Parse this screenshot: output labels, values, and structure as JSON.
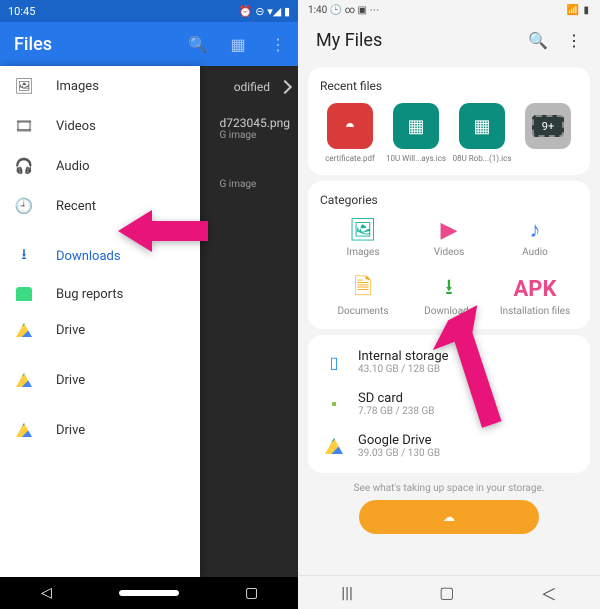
{
  "left": {
    "status_time": "10:45",
    "app_title": "Files",
    "sort_label": "odified",
    "bg_file_name": "d723045.png",
    "bg_file_sub": "G image",
    "bg_file_sub2": "G image",
    "drawer": [
      {
        "icon": "🖼",
        "label": "Images"
      },
      {
        "icon": "🎞",
        "label": "Videos"
      },
      {
        "icon": "🎧",
        "label": "Audio"
      },
      {
        "icon": "🕘",
        "label": "Recent"
      }
    ],
    "downloads_label": "Downloads",
    "bug_label": "Bug reports",
    "drive_label": "Drive"
  },
  "right": {
    "status_time": "1:40",
    "title": "My Files",
    "recent_title": "Recent files",
    "recent": [
      {
        "label": "certificate.pdf"
      },
      {
        "label": "10U Will...ays.ics"
      },
      {
        "label": "08U Rob...(1).ics"
      },
      {
        "label": ""
      }
    ],
    "nine_plus": "9+",
    "categories_title": "Categories",
    "cats": [
      {
        "label": "Images"
      },
      {
        "label": "Videos"
      },
      {
        "label": "Audio"
      },
      {
        "label": "Documents"
      },
      {
        "label": "Downloads"
      },
      {
        "label": "Installation files"
      }
    ],
    "apk_text": "APK",
    "storage": [
      {
        "name": "Internal storage",
        "sub": "43.10 GB / 128 GB"
      },
      {
        "name": "SD card",
        "sub": "7.78 GB / 238 GB"
      },
      {
        "name": "Google Drive",
        "sub": "39.03 GB / 130 GB"
      }
    ],
    "hint": "See what's taking up space in your storage."
  }
}
